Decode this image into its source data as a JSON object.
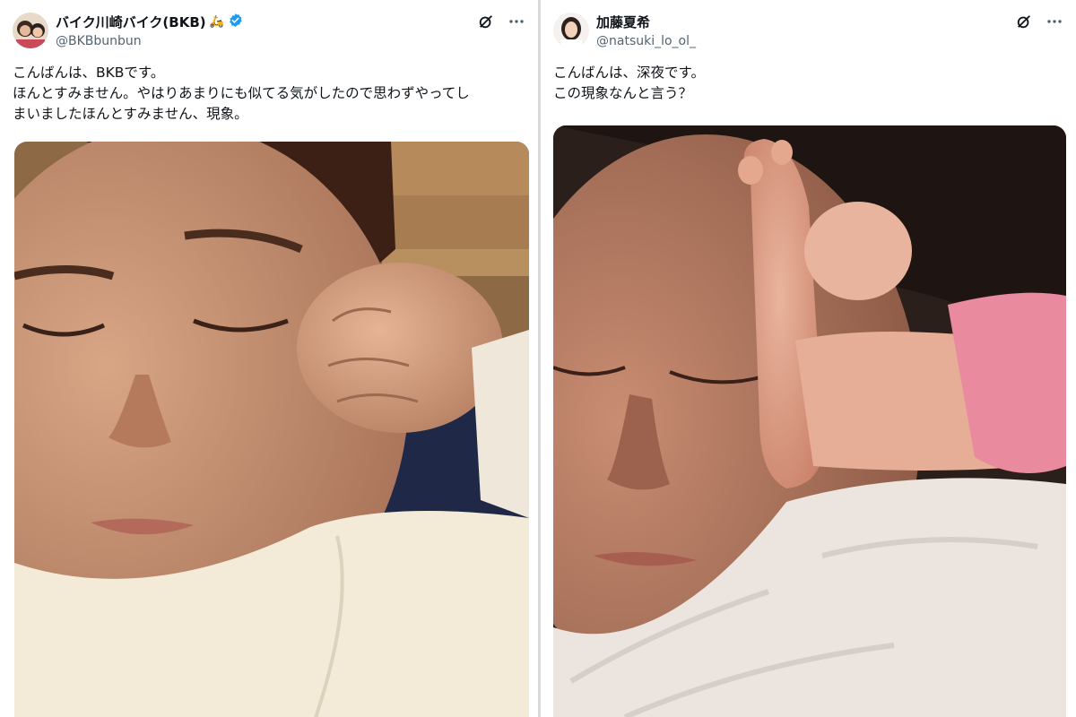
{
  "tweets": [
    {
      "display_name": "バイク川崎バイク(BKB)",
      "name_emoji": "🛵",
      "handle": "@BKBbunbun",
      "verified": true,
      "lines": [
        "こんばんは、BKBです。",
        "ほんとすみません。やはりあまりにも似てる気がしたので思わずやってし",
        "まいましたほんとすみません、現象。"
      ],
      "photo": "man-sleeping-fist-on-cheek"
    },
    {
      "display_name": "加藤夏希",
      "handle": "@natsuki_lo_ol_",
      "verified": false,
      "lines": [
        "こんばんは、深夜です。",
        "この現象なんと言う？"
      ],
      "photo": "woman-sleeping-baby-foot-on-cheek"
    }
  ],
  "icons": {
    "grok": "grok-icon",
    "more": "more-icon",
    "verified": "verified-badge-icon"
  },
  "colors": {
    "verified": "#1d9bf0",
    "text": "#0f1419",
    "handle": "#536471"
  }
}
